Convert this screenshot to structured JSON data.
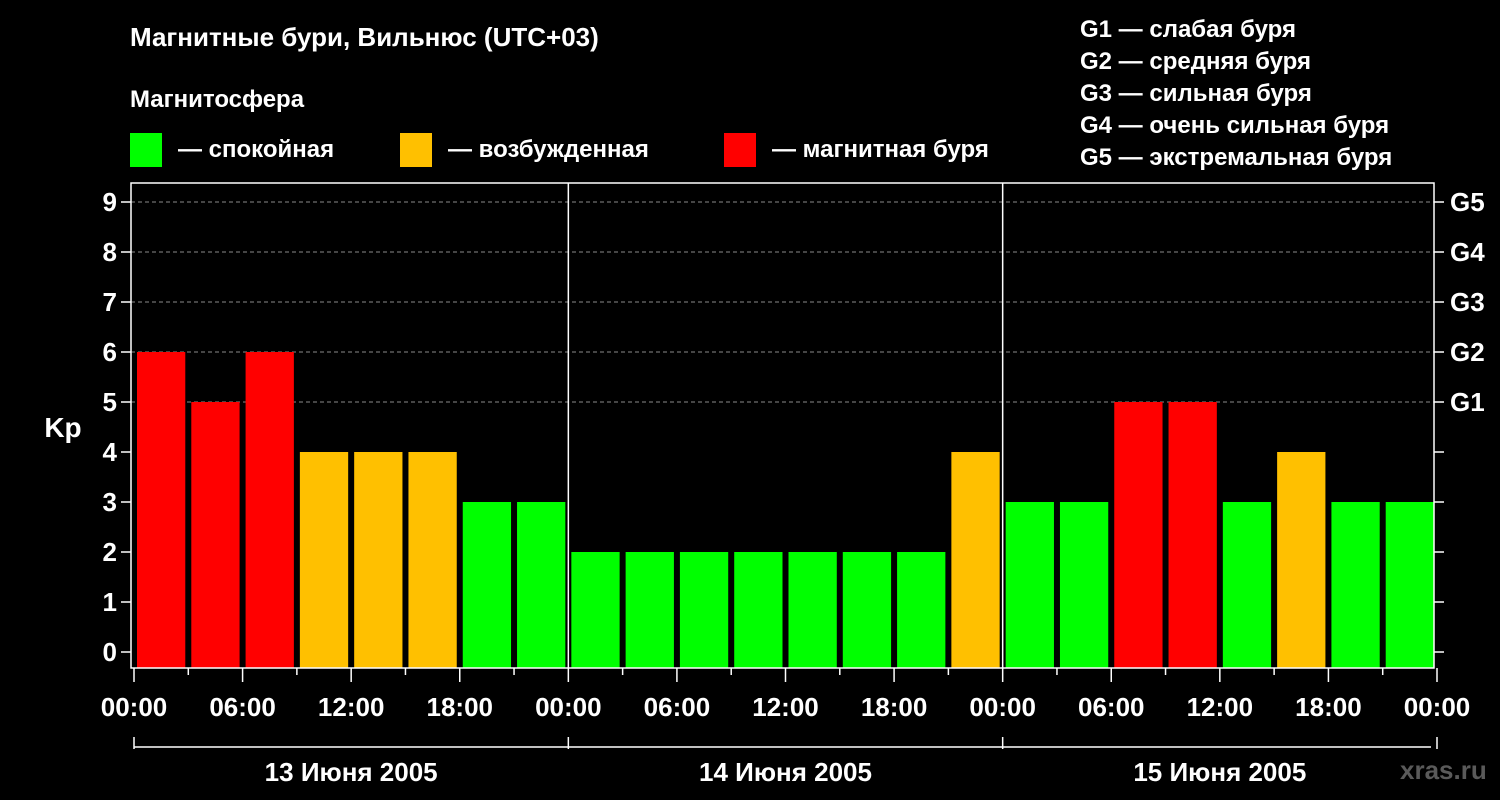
{
  "chart_data": {
    "type": "bar",
    "title": "Магнитные бури, Вильнюс (UTC+03)",
    "ylabel": "Kp",
    "ylim": [
      0,
      9
    ],
    "yticks": [
      "0",
      "1",
      "2",
      "3",
      "4",
      "5",
      "6",
      "7",
      "8",
      "9"
    ],
    "right_ticks": [
      {
        "kp": 5,
        "label": "G1"
      },
      {
        "kp": 6,
        "label": "G2"
      },
      {
        "kp": 7,
        "label": "G3"
      },
      {
        "kp": 8,
        "label": "G4"
      },
      {
        "kp": 9,
        "label": "G5"
      }
    ],
    "grid": "dashed horizontal at Kp 5–9",
    "xtick_labels": [
      "00:00",
      "06:00",
      "12:00",
      "18:00",
      "00:00",
      "06:00",
      "12:00",
      "18:00",
      "00:00",
      "06:00",
      "12:00",
      "18:00",
      "00:00"
    ],
    "days": [
      "13 Июня 2005",
      "14 Июня 2005",
      "15 Июня 2005"
    ],
    "intervals_per_day": 8,
    "values": [
      6,
      5,
      6,
      4,
      4,
      4,
      3,
      3,
      2,
      2,
      2,
      2,
      2,
      2,
      2,
      4,
      3,
      3,
      5,
      5,
      3,
      4,
      3,
      3
    ],
    "levels": {
      "quiet": {
        "label": "— спокойная",
        "color": "#00ff00"
      },
      "active": {
        "label": "— возбужденная",
        "color": "#ffc000"
      },
      "storm": {
        "label": "— магнитная буря",
        "color": "#ff0000"
      }
    },
    "legend_heading": "Магнитосфера",
    "g_scale": [
      "G1 — слабая буря",
      "G2 — средняя буря",
      "G3 — сильная буря",
      "G4 — очень сильная буря",
      "G5 — экстремальная буря"
    ]
  },
  "watermark": "xras.ru"
}
